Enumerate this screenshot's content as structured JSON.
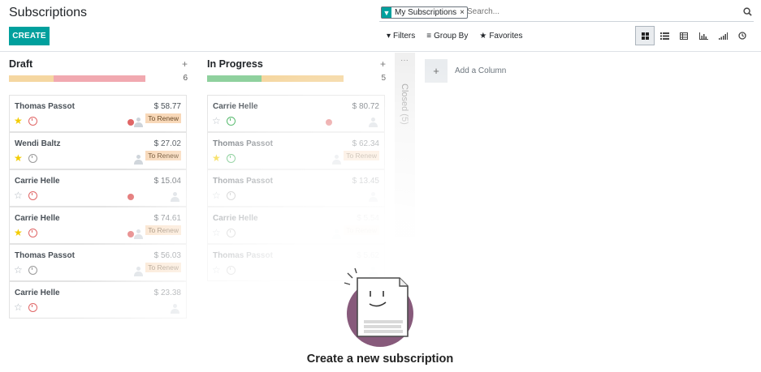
{
  "app": {
    "title": "Subscriptions"
  },
  "controls": {
    "create_label": "CREATE",
    "facet_label": "My Subscriptions",
    "search_placeholder": "Search...",
    "filters_label": "Filters",
    "group_by_label": "Group By",
    "favorites_label": "Favorites"
  },
  "colors": {
    "accent": "#00a09d",
    "fold_green": "#8fd19e",
    "fold_orange": "#f5d7a1",
    "fold_red": "#f1a9b0"
  },
  "columns": [
    {
      "title": "Draft",
      "count": "6",
      "progress": [
        {
          "color": "#f5d7a1",
          "fraction": 0.33
        },
        {
          "color": "#f1a9b0",
          "fraction": 0.67
        }
      ],
      "cards": [
        {
          "name": "Thomas Passot",
          "amount": "$ 58.77",
          "favorite": true,
          "activity": "red",
          "dot": true,
          "tag": "To Renew"
        },
        {
          "name": "Wendi Baltz",
          "amount": "$ 27.02",
          "favorite": true,
          "activity": "grey",
          "dot": false,
          "tag": "To Renew"
        },
        {
          "name": "Carrie Helle",
          "amount": "$ 15.04",
          "favorite": false,
          "activity": "red",
          "dot": true,
          "tag": ""
        },
        {
          "name": "Carrie Helle",
          "amount": "$ 74.61",
          "favorite": true,
          "activity": "red",
          "dot": true,
          "tag": "To Renew"
        },
        {
          "name": "Thomas Passot",
          "amount": "$ 56.03",
          "favorite": false,
          "activity": "grey",
          "dot": false,
          "tag": "To Renew"
        },
        {
          "name": "Carrie Helle",
          "amount": "$ 23.38",
          "favorite": false,
          "activity": "red",
          "dot": false,
          "tag": ""
        }
      ]
    },
    {
      "title": "In Progress",
      "count": "5",
      "progress": [
        {
          "color": "#8fd19e",
          "fraction": 0.4
        },
        {
          "color": "#f5d7a1",
          "fraction": 0.6
        }
      ],
      "cards": [
        {
          "name": "Carrie Helle",
          "amount": "$ 80.72",
          "favorite": false,
          "activity": "green",
          "dot": true,
          "tag": ""
        },
        {
          "name": "Thomas Passot",
          "amount": "$ 62.34",
          "favorite": true,
          "activity": "green",
          "dot": false,
          "tag": "To Renew"
        },
        {
          "name": "Thomas Passot",
          "amount": "$ 13.45",
          "favorite": false,
          "activity": "grey",
          "dot": false,
          "tag": ""
        },
        {
          "name": "Carrie Helle",
          "amount": "$ 5.54",
          "favorite": false,
          "activity": "grey",
          "dot": false,
          "tag": "To Renew"
        },
        {
          "name": "Thomas Passot",
          "amount": "$ 5.62",
          "favorite": false,
          "activity": "grey",
          "dot": false,
          "tag": ""
        }
      ]
    }
  ],
  "folded_column": {
    "label": "Closed (5)"
  },
  "add_column_label": "Add a Column",
  "helper": {
    "title": "Create a new subscription"
  }
}
